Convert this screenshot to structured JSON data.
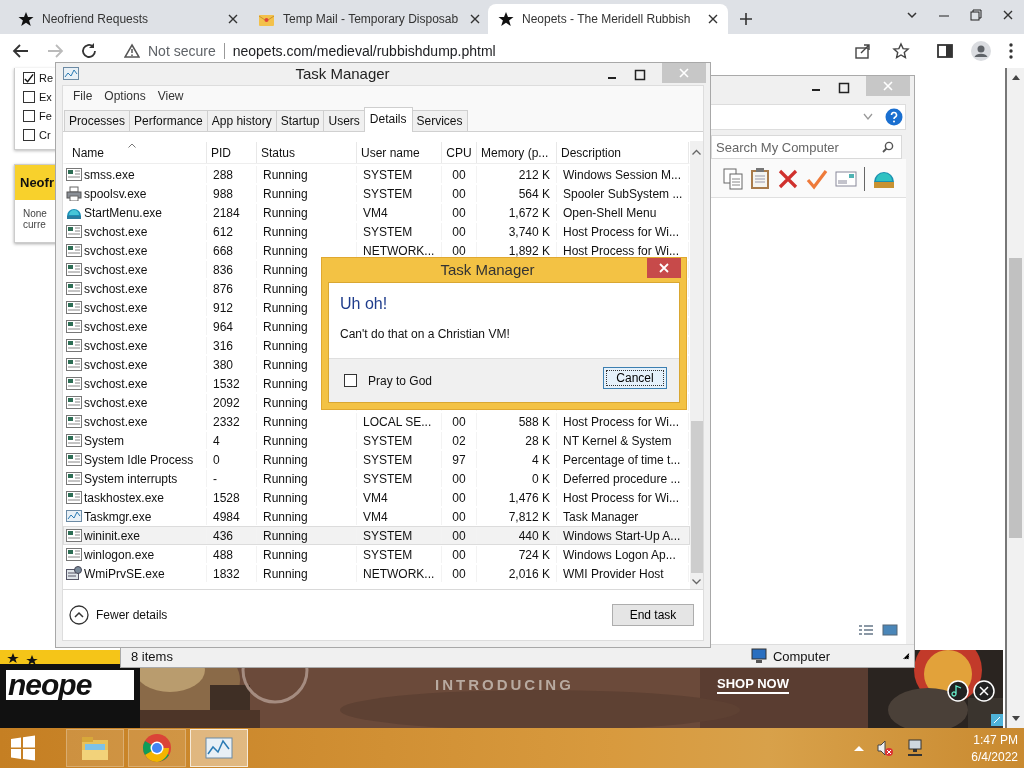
{
  "browser": {
    "tabs": [
      {
        "title": "Neofriend Requests",
        "kind": "star",
        "selected": false
      },
      {
        "title": "Temp Mail - Temporary Disposab",
        "kind": "mail",
        "selected": false
      },
      {
        "title": "Neopets - The Meridell Rubbish",
        "kind": "star",
        "selected": true
      }
    ],
    "address": {
      "security": "Not secure",
      "url": "neopets.com/medieval/rubbishdump.phtml"
    }
  },
  "page": {
    "options": [
      {
        "label": "Re",
        "checked": true
      },
      {
        "label": "Ex",
        "checked": false
      },
      {
        "label": "Fe",
        "checked": false
      },
      {
        "label": "Cr",
        "checked": false
      }
    ],
    "neofriends": {
      "heading": "Neofr",
      "lines": [
        "None",
        "curre"
      ]
    },
    "ad": {
      "logo": "neope",
      "headline": "INTRODUCING",
      "cta": "SHOP NOW"
    }
  },
  "explorer": {
    "search_placeholder": "Search My Computer",
    "status": "8 items",
    "location": "Computer"
  },
  "task_manager": {
    "title": "Task Manager",
    "menu": [
      "File",
      "Options",
      "View"
    ],
    "tabs": [
      {
        "label": "Processes",
        "selected": false
      },
      {
        "label": "Performance",
        "selected": false
      },
      {
        "label": "App history",
        "selected": false
      },
      {
        "label": "Startup",
        "selected": false
      },
      {
        "label": "Users",
        "selected": false
      },
      {
        "label": "Details",
        "selected": true
      },
      {
        "label": "Services",
        "selected": false
      }
    ],
    "columns": [
      "Name",
      "PID",
      "Status",
      "User name",
      "CPU",
      "Memory (p...",
      "Description"
    ],
    "rows": [
      {
        "kind": "app",
        "selected": false,
        "cells": [
          "smss.exe",
          "288",
          "Running",
          "SYSTEM",
          "00",
          "212 K",
          "Windows Session M..."
        ]
      },
      {
        "kind": "printer",
        "selected": false,
        "cells": [
          "spoolsv.exe",
          "988",
          "Running",
          "SYSTEM",
          "00",
          "564 K",
          "Spooler SubSystem ..."
        ]
      },
      {
        "kind": "shell",
        "selected": false,
        "cells": [
          "StartMenu.exe",
          "2184",
          "Running",
          "VM4",
          "00",
          "1,672 K",
          "Open-Shell Menu"
        ]
      },
      {
        "kind": "app",
        "selected": false,
        "cells": [
          "svchost.exe",
          "612",
          "Running",
          "SYSTEM",
          "00",
          "3,740 K",
          "Host Process for Wi..."
        ]
      },
      {
        "kind": "app",
        "selected": false,
        "cells": [
          "svchost.exe",
          "668",
          "Running",
          "NETWORK...",
          "00",
          "1,892 K",
          "Host Process for Wi..."
        ]
      },
      {
        "kind": "app",
        "selected": false,
        "cells": [
          "svchost.exe",
          "836",
          "Running"
        ]
      },
      {
        "kind": "app",
        "selected": false,
        "cells": [
          "svchost.exe",
          "876",
          "Running"
        ]
      },
      {
        "kind": "app",
        "selected": false,
        "cells": [
          "svchost.exe",
          "912",
          "Running"
        ]
      },
      {
        "kind": "app",
        "selected": false,
        "cells": [
          "svchost.exe",
          "964",
          "Running"
        ]
      },
      {
        "kind": "app",
        "selected": false,
        "cells": [
          "svchost.exe",
          "316",
          "Running"
        ]
      },
      {
        "kind": "app",
        "selected": false,
        "cells": [
          "svchost.exe",
          "380",
          "Running"
        ]
      },
      {
        "kind": "app",
        "selected": false,
        "cells": [
          "svchost.exe",
          "1532",
          "Running"
        ]
      },
      {
        "kind": "app",
        "selected": false,
        "cells": [
          "svchost.exe",
          "2092",
          "Running"
        ]
      },
      {
        "kind": "app",
        "selected": false,
        "cells": [
          "svchost.exe",
          "2332",
          "Running",
          "LOCAL SE...",
          "00",
          "588 K",
          "Host Process for Wi..."
        ]
      },
      {
        "kind": "app",
        "selected": false,
        "cells": [
          "System",
          "4",
          "Running",
          "SYSTEM",
          "02",
          "28 K",
          "NT Kernel & System"
        ]
      },
      {
        "kind": "app",
        "selected": false,
        "cells": [
          "System Idle Process",
          "0",
          "Running",
          "SYSTEM",
          "97",
          "4 K",
          "Percentage of time t..."
        ]
      },
      {
        "kind": "app",
        "selected": false,
        "cells": [
          "System interrupts",
          "-",
          "Running",
          "SYSTEM",
          "00",
          "0 K",
          "Deferred procedure ..."
        ]
      },
      {
        "kind": "app",
        "selected": false,
        "cells": [
          "taskhostex.exe",
          "1528",
          "Running",
          "VM4",
          "00",
          "1,476 K",
          "Host Process for Wi..."
        ]
      },
      {
        "kind": "monitor",
        "selected": false,
        "cells": [
          "Taskmgr.exe",
          "4984",
          "Running",
          "VM4",
          "00",
          "7,812 K",
          "Task Manager"
        ]
      },
      {
        "kind": "app",
        "selected": true,
        "cells": [
          "wininit.exe",
          "436",
          "Running",
          "SYSTEM",
          "00",
          "440 K",
          "Windows Start-Up A..."
        ]
      },
      {
        "kind": "app",
        "selected": false,
        "cells": [
          "winlogon.exe",
          "488",
          "Running",
          "SYSTEM",
          "00",
          "724 K",
          "Windows Logon Ap..."
        ]
      },
      {
        "kind": "wmi",
        "selected": false,
        "cells": [
          "WmiPrvSE.exe",
          "1832",
          "Running",
          "NETWORK...",
          "00",
          "2,016 K",
          "WMI Provider Host"
        ]
      }
    ],
    "fewer_details": "Fewer details",
    "end_task": "End task"
  },
  "dialog": {
    "title": "Task Manager",
    "heading": "Uh oh!",
    "message": "Can't do that on a Christian VM!",
    "checkbox": {
      "label": "Pray to God",
      "checked": false
    },
    "button": "Cancel"
  },
  "taskbar": {
    "apps": [
      {
        "kind": "files",
        "active": false
      },
      {
        "kind": "chrome",
        "active": false
      },
      {
        "kind": "taskmgr",
        "active": true
      }
    ],
    "time": "1:47 PM",
    "date": "6/4/2022"
  }
}
